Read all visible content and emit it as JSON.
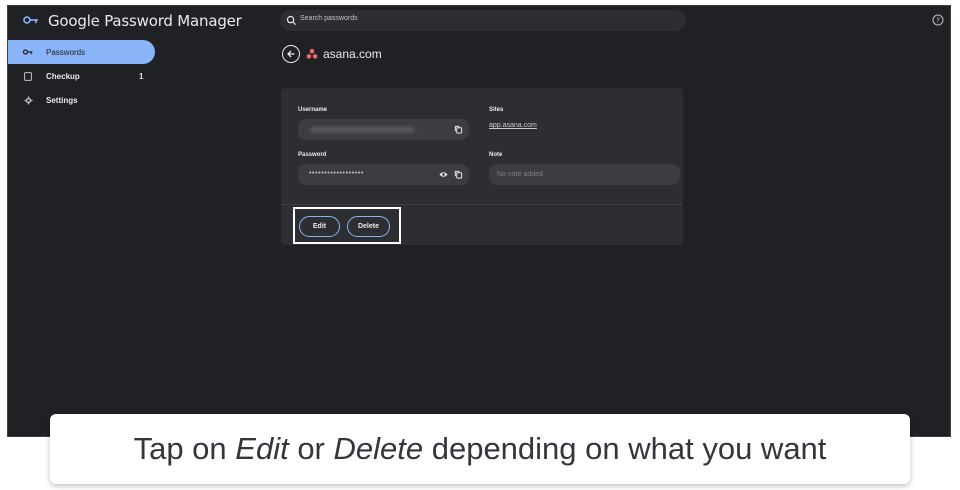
{
  "app": {
    "title": "Google Password Manager"
  },
  "search": {
    "placeholder": "Search passwords"
  },
  "sidebar": {
    "items": [
      {
        "label": "Passwords",
        "active": true,
        "icon": "key-icon"
      },
      {
        "label": "Checkup",
        "count": "1",
        "icon": "checkup-icon"
      },
      {
        "label": "Settings",
        "icon": "gear-icon"
      }
    ]
  },
  "detail": {
    "site_title": "asana.com",
    "username_label": "Username",
    "password_label": "Password",
    "password_masked": "••••••••••••••••••",
    "sites_label": "Sites",
    "sites_value": "app.asana.com",
    "note_label": "Note",
    "note_placeholder": "No note added",
    "edit_label": "Edit",
    "delete_label": "Delete"
  },
  "caption": {
    "prefix": "Tap on ",
    "edit": "Edit",
    "middle": " or ",
    "delete": "Delete",
    "suffix": " depending on what you want"
  },
  "colors": {
    "window_bg": "#202124",
    "card_bg": "#2d2e31",
    "accent": "#8ab4f8",
    "asana": "#f06a6a"
  }
}
